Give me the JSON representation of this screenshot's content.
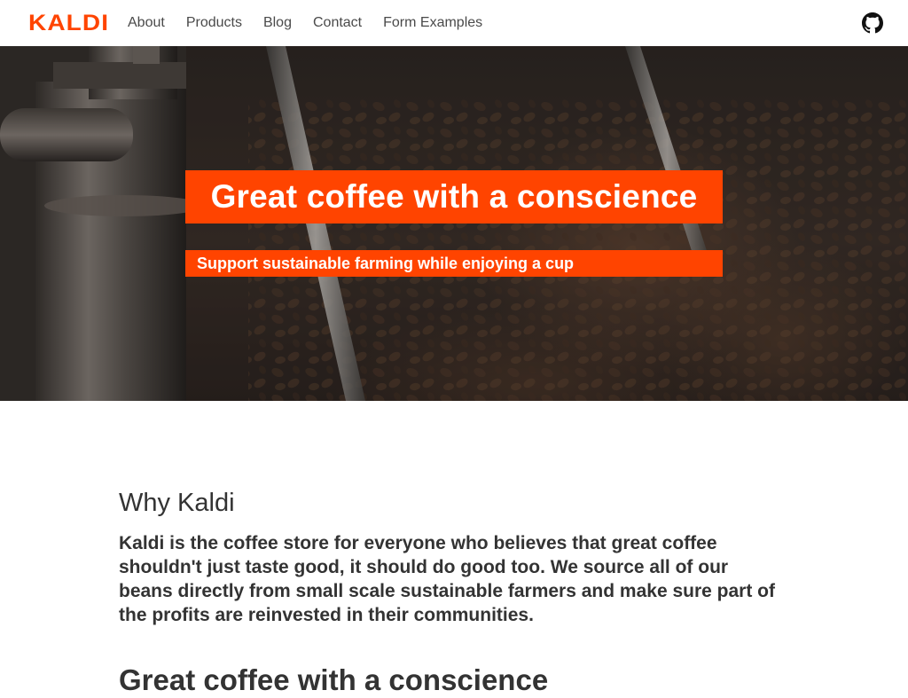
{
  "navbar": {
    "logo": "KALDI",
    "links": [
      {
        "label": "About"
      },
      {
        "label": "Products"
      },
      {
        "label": "Blog"
      },
      {
        "label": "Contact"
      },
      {
        "label": "Form Examples"
      }
    ],
    "github_icon": "github-icon"
  },
  "hero": {
    "title": "Great coffee with a conscience",
    "subtitle": "Support sustainable farming while enjoying a cup"
  },
  "main": {
    "heading": "Why Kaldi",
    "description": "Kaldi is the coffee store for everyone who believes that great coffee shouldn't just taste good, it should do good too. We source all of our beans directly from small scale sustainable farmers and make sure part of the profits are reinvested in their communities.",
    "second_heading": "Great coffee with a conscience"
  },
  "colors": {
    "accent": "#ff4400",
    "text": "#333333",
    "nav_text": "#4a4a4a"
  }
}
